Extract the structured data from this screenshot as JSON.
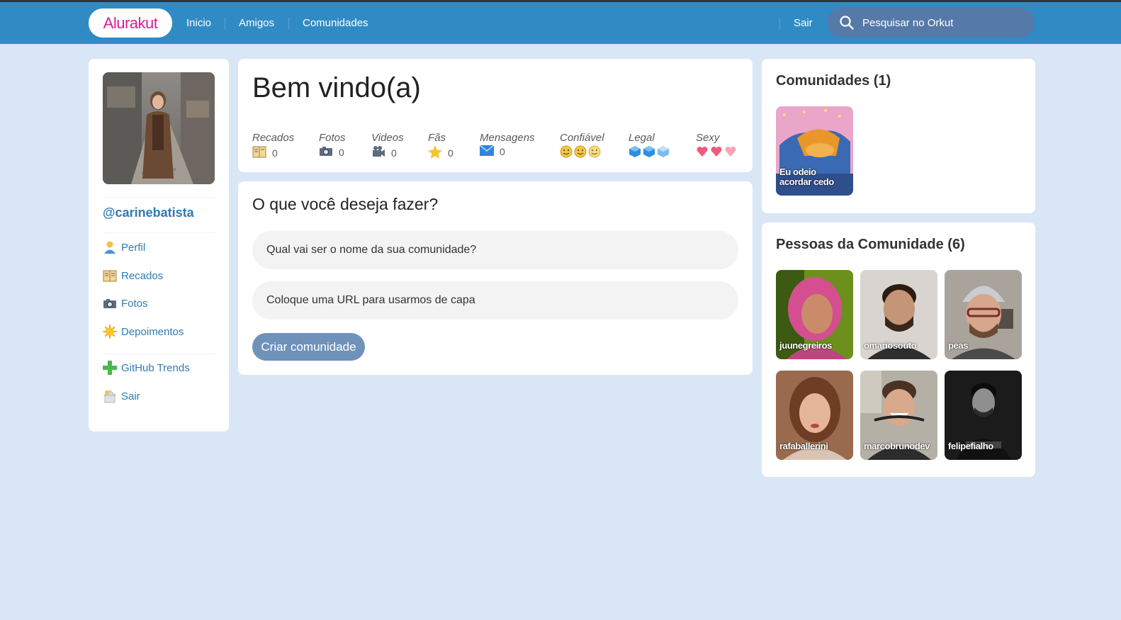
{
  "header": {
    "logo": "Alurakut",
    "nav": [
      "Inicio",
      "Amigos",
      "Comunidades"
    ],
    "logout": "Sair",
    "search_placeholder": "Pesquisar no Orkut"
  },
  "sidebar": {
    "username": "@carinebatista",
    "items": [
      {
        "label": "Perfil",
        "icon": "user-icon"
      },
      {
        "label": "Recados",
        "icon": "book-icon"
      },
      {
        "label": "Fotos",
        "icon": "camera-icon"
      },
      {
        "label": "Depoimentos",
        "icon": "sun-icon"
      },
      {
        "label": "GitHub Trends",
        "icon": "plus-icon"
      },
      {
        "label": "Sair",
        "icon": "logout-icon"
      }
    ]
  },
  "welcome": {
    "title": "Bem vindo(a)",
    "stats": [
      {
        "label": "Recados",
        "value": "0",
        "icon": "book-icon"
      },
      {
        "label": "Fotos",
        "value": "0",
        "icon": "camera-icon"
      },
      {
        "label": "Videos",
        "value": "0",
        "icon": "video-camera-icon"
      },
      {
        "label": "Fãs",
        "value": "0",
        "icon": "star-icon"
      },
      {
        "label": "Mensagens",
        "value": "0",
        "icon": "envelope-icon"
      },
      {
        "label": "Confiável",
        "icon": "smiley-icon",
        "level": 3
      },
      {
        "label": "Legal",
        "icon": "cube-icon",
        "level": 3
      },
      {
        "label": "Sexy",
        "icon": "heart-icon",
        "level": 3
      }
    ]
  },
  "action": {
    "title": "O que você deseja fazer?",
    "name_placeholder": "Qual vai ser o nome da sua comunidade?",
    "url_placeholder": "Coloque uma URL para usarmos de capa",
    "submit_label": "Criar comunidade"
  },
  "communities": {
    "title": "Comunidades (1)",
    "items": [
      {
        "name": "Eu odeio acordar cedo"
      }
    ]
  },
  "people": {
    "title": "Pessoas da Comunidade (6)",
    "items": [
      {
        "name": "juunegreiros"
      },
      {
        "name": "omariosouto"
      },
      {
        "name": "peas"
      },
      {
        "name": "rafaballerini"
      },
      {
        "name": "marcobrunodev"
      },
      {
        "name": "felipefialho"
      }
    ]
  },
  "colors": {
    "header_bg": "#308BC5",
    "page_bg": "#D9E6F6",
    "logo_text": "#D81D99",
    "link": "#2E7BB4",
    "button": "#6F92BB",
    "search_bg": "#5579A9"
  }
}
